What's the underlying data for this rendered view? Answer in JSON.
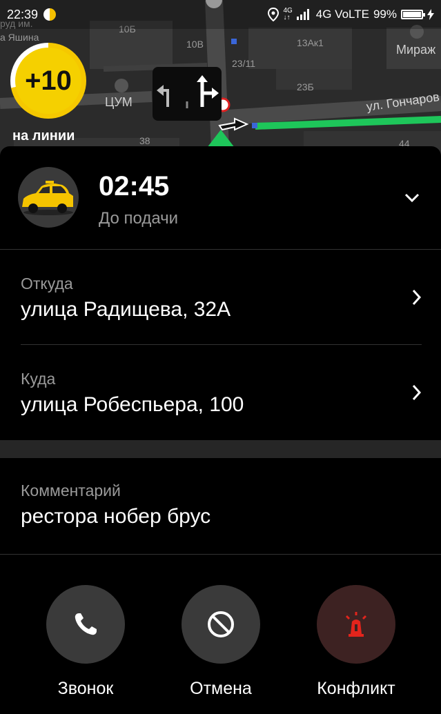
{
  "status_bar": {
    "time": "22:39",
    "network": "4G",
    "network_sub": "4G",
    "network_label": "4G VoLTE",
    "battery": "99%",
    "battery_level": 0.99
  },
  "map": {
    "labels": {
      "pud": "руд им.",
      "yashina": "а Яшина",
      "n10b": "10Б",
      "n10v": "10В",
      "n13ak1": "13Ак1",
      "mirazh": "Мираж",
      "n23_11": "23/11",
      "n23b": "23Б",
      "tsum": "ЦУМ",
      "n38": "38",
      "n44": "44"
    },
    "street": "ул. Гончаров"
  },
  "bonus": {
    "value": "+10",
    "status": "на линии",
    "progress": 0.72
  },
  "order": {
    "eta": "02:45",
    "eta_label": "До подачи",
    "from_label": "Откуда",
    "from": "улица Радищева, 32А",
    "to_label": "Куда",
    "to": "улица Робеспьера, 100",
    "comment_label": "Комментарий",
    "comment": "ресторa нобер брус"
  },
  "actions": {
    "call": "Звонок",
    "cancel": "Отмена",
    "conflict": "Конфликт"
  },
  "colors": {
    "route": "#1ec65a",
    "accent": "#f5d000",
    "danger": "#e2241c"
  }
}
